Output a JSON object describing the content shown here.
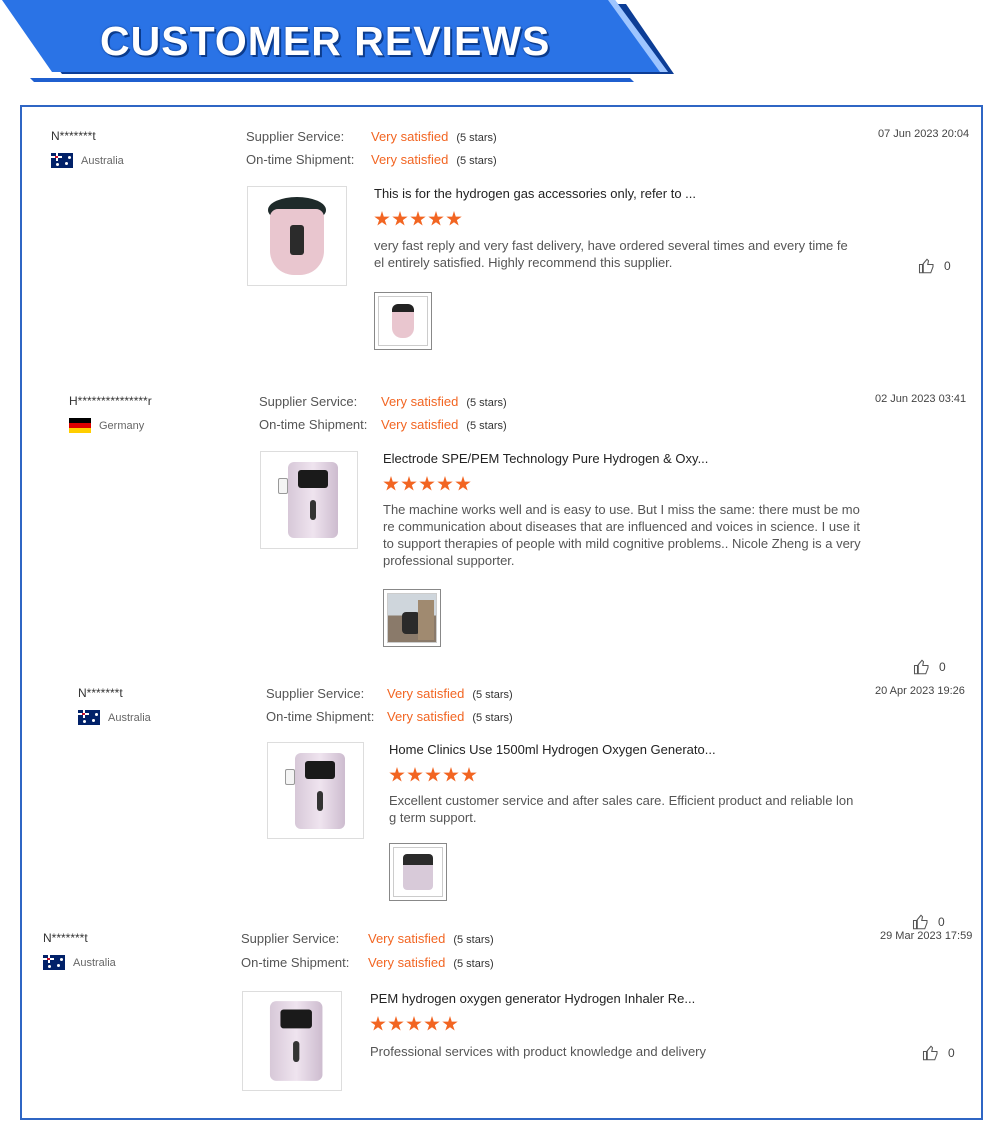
{
  "banner": {
    "title": "CUSTOMER REVIEWS"
  },
  "colors": {
    "accent": "#f26522",
    "frame": "#2f66c4",
    "banner": "#2a73e6"
  },
  "reviews": [
    {
      "name": "N*******t",
      "country": "Australia",
      "flag": "australia-flag",
      "date": "07 Jun 2023 20:04",
      "supplier_label": "Supplier Service:",
      "supplier_value": "Very satisfied",
      "supplier_stars": "(5 stars)",
      "shipment_label": "On-time Shipment:",
      "shipment_value": "Very satisfied",
      "shipment_stars": "(5 stars)",
      "product_title": "This is for the hydrogen gas accessories only, refer to ...",
      "rating": 5,
      "text": "very fast reply and very fast delivery, have ordered several times and every time feel entirely satisfied. Highly recommend this supplier.",
      "likes": "0"
    },
    {
      "name": "H***************r",
      "country": "Germany",
      "flag": "germany-flag",
      "date": "02 Jun 2023 03:41",
      "supplier_label": "Supplier Service:",
      "supplier_value": "Very satisfied",
      "supplier_stars": "(5 stars)",
      "shipment_label": "On-time Shipment:",
      "shipment_value": "Very satisfied",
      "shipment_stars": "(5 stars)",
      "product_title": "Electrode SPE/PEM Technology Pure Hydrogen & Oxy...",
      "rating": 5,
      "text": "The machine works well and is easy to use. But I miss the same: there must be more communication about diseases that are influenced and voices in science. I use it to support therapies of people with mild cognitive problems.. Nicole Zheng is a very professional supporter.",
      "likes": "0"
    },
    {
      "name": "N*******t",
      "country": "Australia",
      "flag": "australia-flag",
      "date": "20 Apr 2023 19:26",
      "supplier_label": "Supplier Service:",
      "supplier_value": "Very satisfied",
      "supplier_stars": "(5 stars)",
      "shipment_label": "On-time Shipment:",
      "shipment_value": "Very satisfied",
      "shipment_stars": "(5 stars)",
      "product_title": "Home Clinics Use 1500ml Hydrogen Oxygen Generato...",
      "rating": 5,
      "text": "Excellent customer service and after sales care. Efficient product and reliable long term support.",
      "likes": "0"
    },
    {
      "name": "N*******t",
      "country": "Australia",
      "flag": "australia-flag",
      "date": "29 Mar 2023 17:59",
      "supplier_label": "Supplier Service:",
      "supplier_value": "Very satisfied",
      "supplier_stars": "(5 stars)",
      "shipment_label": "On-time Shipment:",
      "shipment_value": "Very satisfied",
      "shipment_stars": "(5 stars)",
      "product_title": "PEM hydrogen oxygen generator Hydrogen Inhaler Re...",
      "rating": 5,
      "text": "Professional services with product knowledge and delivery",
      "likes": "0"
    }
  ]
}
